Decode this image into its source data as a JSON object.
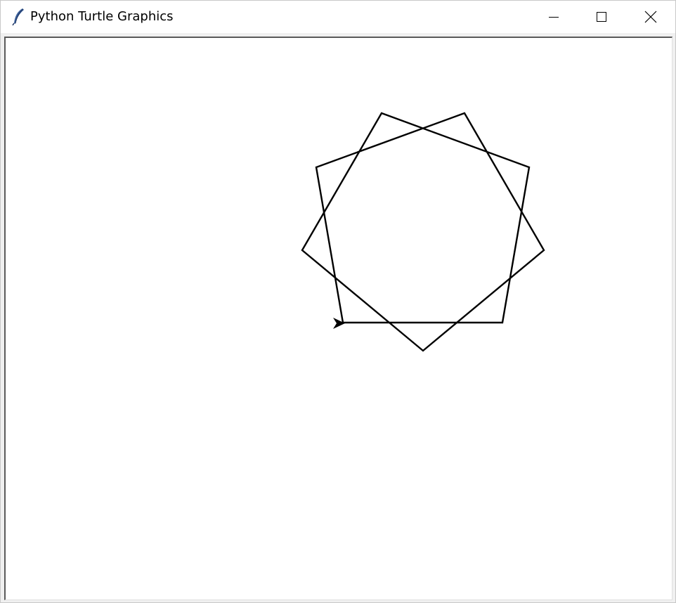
{
  "window": {
    "title": "Python Turtle Graphics",
    "app_icon": "feather-icon",
    "controls": {
      "minimize_icon": "minimize-icon",
      "maximize_icon": "maximize-icon",
      "close_icon": "close-icon"
    }
  },
  "canvas": {
    "background": "#ffffff",
    "pen_color": "#000000",
    "figure": "nine-pointed star polygon",
    "turtle_cursor": "arrow-icon"
  }
}
